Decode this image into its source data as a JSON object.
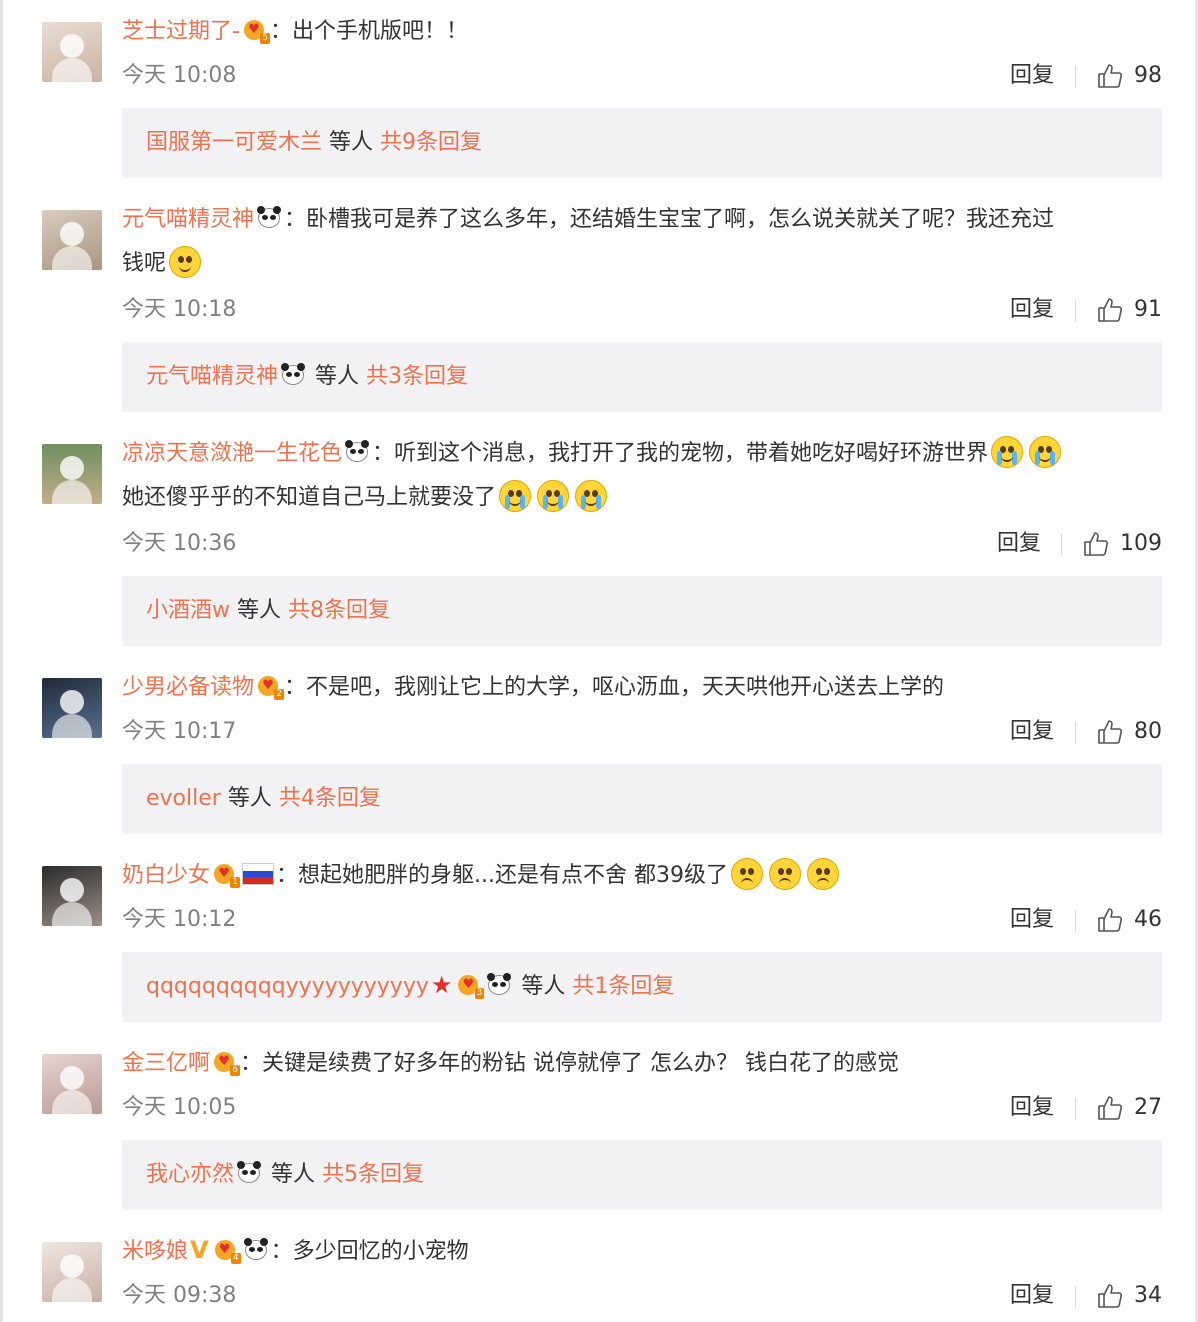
{
  "labels": {
    "reply": "回复",
    "others": "等人"
  },
  "comments": [
    {
      "user": "芝士过期了-",
      "badges": [
        "crown-5"
      ],
      "text": "出个手机版吧！！",
      "time": "今天 10:08",
      "likes": "98",
      "reply_user": "国服第一可爱木兰",
      "reply_badges": [],
      "reply_count": "共9条回复"
    },
    {
      "user": "元气喵精灵神",
      "badges": [
        "panda"
      ],
      "text": "卧槽我可是养了这么多年，还结婚生宝宝了啊，怎么说关就关了呢？我还充过",
      "text2": "钱呢",
      "time": "今天 10:18",
      "likes": "91",
      "reply_user": "元气喵精灵神",
      "reply_badges": [
        "panda"
      ],
      "reply_count": "共3条回复"
    },
    {
      "user": "凉凉天意潋滟一生花色",
      "badges": [
        "panda"
      ],
      "text": "听到这个消息，我打开了我的宠物，带着她吃好喝好环游世界",
      "text2": "她还傻乎乎的不知道自己马上就要没了",
      "time": "今天 10:36",
      "likes": "109",
      "reply_user": "小酒酒w",
      "reply_badges": [],
      "reply_count": "共8条回复"
    },
    {
      "user": "少男必备读物",
      "badges": [
        "crown-2"
      ],
      "text": "不是吧，我刚让它上的大学，呕心沥血，天天哄他开心送去上学的",
      "time": "今天 10:17",
      "likes": "80",
      "reply_user": "evoller",
      "reply_badges": [],
      "reply_count": "共4条回复"
    },
    {
      "user": "奶白少女",
      "badges": [
        "crown-1",
        "flag-ru"
      ],
      "text": "想起她肥胖的身躯...还是有点不舍  都39级了",
      "time": "今天 10:12",
      "likes": "46",
      "reply_user": "qqqqqqqqqqyyyyyyyyyyy",
      "reply_badges": [
        "star",
        "crown-3",
        "panda"
      ],
      "reply_count": "共1条回复"
    },
    {
      "user": "金三亿啊",
      "badges": [
        "crown-6"
      ],
      "text": "关键是续费了好多年的粉钻 说停就停了 怎么办？ 钱白花了的感觉",
      "time": "今天 10:05",
      "likes": "27",
      "reply_user": "我心亦然",
      "reply_badges": [
        "panda"
      ],
      "reply_count": "共5条回复"
    },
    {
      "user": "米哆娘",
      "badges": [
        "vip-v",
        "crown-4",
        "panda"
      ],
      "text": "多少回忆的小宠物",
      "time": "今天 09:38",
      "likes": "34"
    }
  ],
  "colors": {
    "username": "#eb7350",
    "reply_bg": "#f2f2f5",
    "meta": "#808080"
  }
}
